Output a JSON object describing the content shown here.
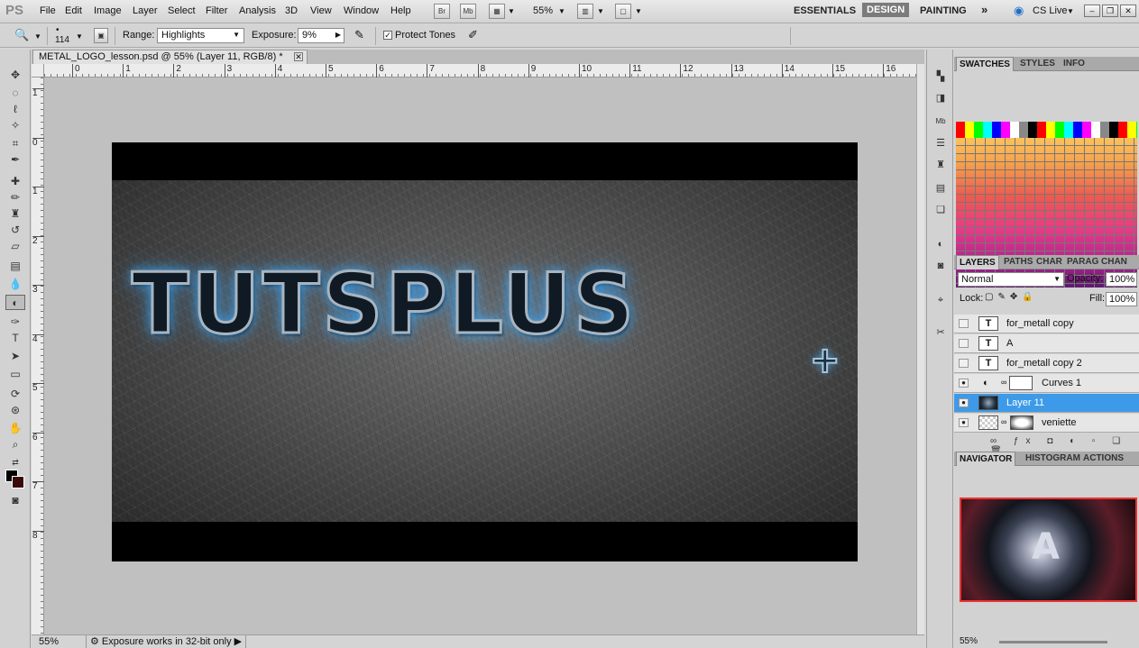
{
  "app": {
    "logo": "PS"
  },
  "menu": [
    "File",
    "Edit",
    "Image",
    "Layer",
    "Select",
    "Filter",
    "Analysis",
    "3D",
    "View",
    "Window",
    "Help"
  ],
  "toolbar": {
    "bridge": "Br",
    "minibridge": "Mb",
    "zoom_value": "55%"
  },
  "workspaces": {
    "essentials": "ESSENTIALS",
    "design": "DESIGN",
    "painting": "PAINTING",
    "more": "»",
    "cslive": "CS Live"
  },
  "options": {
    "brush_size": "114",
    "range_label": "Range:",
    "range_value": "Highlights",
    "exposure_label": "Exposure:",
    "exposure_value": "9%",
    "protect_tones": "Protect Tones"
  },
  "document": {
    "tab_title": "METAL_LOGO_lesson.psd @ 55% (Layer 11, RGB/8) *",
    "ruler_h": [
      "0",
      "1",
      "2",
      "3",
      "4",
      "5",
      "6",
      "7",
      "8",
      "9",
      "10",
      "11",
      "12",
      "13",
      "14",
      "15",
      "16"
    ],
    "ruler_v": [
      "1",
      "0",
      "1",
      "2",
      "3",
      "4",
      "5",
      "6",
      "7",
      "8"
    ],
    "logo_text": "TUTSPLUS",
    "logo_plus": "+"
  },
  "status": {
    "zoom": "55%",
    "info": "Exposure works in 32-bit only"
  },
  "swatches_panel": {
    "tabs": [
      "SWATCHES",
      "STYLES",
      "INFO"
    ]
  },
  "layers_panel": {
    "tabs": [
      "LAYERS",
      "PATHS",
      "CHAR",
      "PARAG",
      "CHAN"
    ],
    "blend_mode": "Normal",
    "opacity_label": "Opacity:",
    "opacity_value": "100%",
    "lock_label": "Lock:",
    "fill_label": "Fill:",
    "fill_value": "100%",
    "layers": [
      {
        "name": "for_metall copy",
        "thumb": "T",
        "visible": false
      },
      {
        "name": "A",
        "thumb": "T",
        "visible": false
      },
      {
        "name": "for_metall copy 2",
        "thumb": "T",
        "visible": false
      },
      {
        "name": "Curves 1",
        "thumb": "adj",
        "visible": true
      },
      {
        "name": "Layer 11",
        "thumb": "img",
        "visible": true,
        "selected": true
      },
      {
        "name": "veniette",
        "thumb": "img",
        "visible": true
      }
    ]
  },
  "navigator_panel": {
    "tabs": [
      "NAVIGATOR",
      "HISTOGRAM",
      "ACTIONS"
    ],
    "zoom": "55%",
    "logo": "A"
  }
}
